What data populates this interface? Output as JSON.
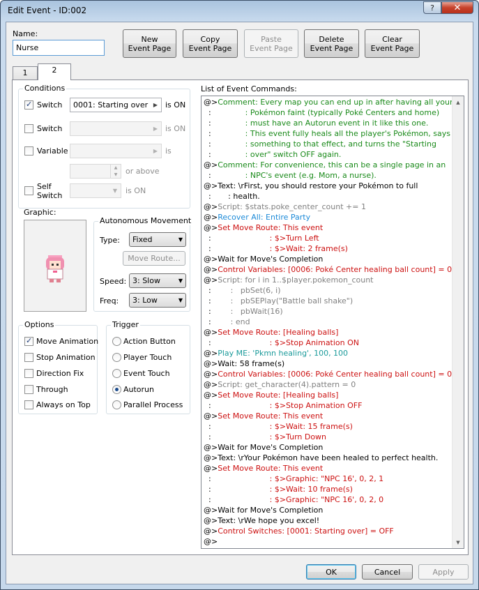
{
  "window": {
    "title": "Edit Event - ID:002",
    "help_glyph": "?",
    "close_glyph": "✕"
  },
  "name_label": "Name:",
  "name_value": "Nurse",
  "toolbar": {
    "new_page": [
      "New",
      "Event Page"
    ],
    "copy_page": [
      "Copy",
      "Event Page"
    ],
    "paste_page": [
      "Paste",
      "Event Page"
    ],
    "delete_page": [
      "Delete",
      "Event Page"
    ],
    "clear_page": [
      "Clear",
      "Event Page"
    ]
  },
  "tabs": [
    "1",
    "2"
  ],
  "active_tab": "2",
  "conditions": {
    "title": "Conditions",
    "switch1": {
      "label": "Switch",
      "checked": true,
      "value": "0001: Starting over",
      "suffix": "is ON"
    },
    "switch2": {
      "label": "Switch",
      "checked": false,
      "value": "",
      "suffix": "is ON"
    },
    "variable": {
      "label": "Variable",
      "checked": false,
      "value": "",
      "suffix": "is",
      "above": "or above"
    },
    "self_switch": {
      "label1": "Self",
      "label2": "Switch",
      "checked": false,
      "value": "",
      "suffix": "is ON"
    }
  },
  "graphic_label": "Graphic:",
  "autonomous": {
    "title": "Autonomous Movement",
    "type_label": "Type:",
    "type_value": "Fixed",
    "move_route": "Move Route...",
    "speed_label": "Speed:",
    "speed_value": "3: Slow",
    "freq_label": "Freq:",
    "freq_value": "3: Low"
  },
  "options": {
    "title": "Options",
    "items": [
      {
        "label": "Move Animation",
        "checked": true
      },
      {
        "label": "Stop Animation",
        "checked": false
      },
      {
        "label": "Direction Fix",
        "checked": false
      },
      {
        "label": "Through",
        "checked": false
      },
      {
        "label": "Always on Top",
        "checked": false
      }
    ]
  },
  "trigger": {
    "title": "Trigger",
    "items": [
      {
        "label": "Action Button",
        "checked": false
      },
      {
        "label": "Player Touch",
        "checked": false
      },
      {
        "label": "Event Touch",
        "checked": false
      },
      {
        "label": "Autorun",
        "checked": true
      },
      {
        "label": "Parallel Process",
        "checked": false
      }
    ]
  },
  "commands_label": "List of Event Commands:",
  "colors": {
    "comment": "#1a8a1a",
    "script": "#808080",
    "party": "#1c8ad8",
    "red": "#cc1010",
    "audio": "#1a9a9a",
    "text": "#000000"
  },
  "commands": [
    [
      [
        "text",
        "@>"
      ],
      [
        "comment",
        "Comment: Every map you can end up in after having all your"
      ]
    ],
    [
      [
        "text",
        "  :              "
      ],
      [
        "comment",
        ": Pokémon faint (typically Poké Centers and home)"
      ]
    ],
    [
      [
        "text",
        "  :              "
      ],
      [
        "comment",
        ": must have an Autorun event in it like this one."
      ]
    ],
    [
      [
        "text",
        "  :              "
      ],
      [
        "comment",
        ": This event fully heals all the player's Pokémon, says"
      ]
    ],
    [
      [
        "text",
        "  :              "
      ],
      [
        "comment",
        ": something to that effect, and turns the \"Starting"
      ]
    ],
    [
      [
        "text",
        "  :              "
      ],
      [
        "comment",
        ": over\" switch OFF again."
      ]
    ],
    [
      [
        "text",
        "@>"
      ],
      [
        "comment",
        "Comment: For convenience, this can be a single page in an"
      ]
    ],
    [
      [
        "text",
        "  :              "
      ],
      [
        "comment",
        ": NPC's event (e.g. Mom, a nurse)."
      ]
    ],
    [
      [
        "text",
        "@>Text: \\rFirst, you should restore your Pokémon to full"
      ]
    ],
    [
      [
        "text",
        "  :       : health."
      ]
    ],
    [
      [
        "text",
        "@>"
      ],
      [
        "script",
        "Script: $stats.poke_center_count += 1"
      ]
    ],
    [
      [
        "text",
        "@>"
      ],
      [
        "party",
        "Recover All: Entire Party"
      ]
    ],
    [
      [
        "text",
        "@>"
      ],
      [
        "red",
        "Set Move Route: This event"
      ]
    ],
    [
      [
        "text",
        "  :                        "
      ],
      [
        "red",
        ": $>Turn Left"
      ]
    ],
    [
      [
        "text",
        "  :                        "
      ],
      [
        "red",
        ": $>Wait: 2 frame(s)"
      ]
    ],
    [
      [
        "text",
        "@>Wait for Move's Completion"
      ]
    ],
    [
      [
        "text",
        "@>"
      ],
      [
        "red",
        "Control Variables: [0006: Poké Center healing ball count] = 0"
      ]
    ],
    [
      [
        "text",
        "@>"
      ],
      [
        "script",
        "Script: for i in 1..$player.pokemon_count"
      ]
    ],
    [
      [
        "text",
        "  :        "
      ],
      [
        "script",
        ":   pbSet(6, i)"
      ]
    ],
    [
      [
        "text",
        "  :        "
      ],
      [
        "script",
        ":   pbSEPlay(\"Battle ball shake\")"
      ]
    ],
    [
      [
        "text",
        "  :        "
      ],
      [
        "script",
        ":   pbWait(16)"
      ]
    ],
    [
      [
        "text",
        "  :        "
      ],
      [
        "script",
        ": end"
      ]
    ],
    [
      [
        "text",
        "@>"
      ],
      [
        "red",
        "Set Move Route: [Healing balls]"
      ]
    ],
    [
      [
        "text",
        "  :                        "
      ],
      [
        "red",
        ": $>Stop Animation ON"
      ]
    ],
    [
      [
        "text",
        "@>"
      ],
      [
        "audio",
        "Play ME: 'Pkmn healing', 100, 100"
      ]
    ],
    [
      [
        "text",
        "@>Wait: 58 frame(s)"
      ]
    ],
    [
      [
        "text",
        "@>"
      ],
      [
        "red",
        "Control Variables: [0006: Poké Center healing ball count] = 0"
      ]
    ],
    [
      [
        "text",
        "@>"
      ],
      [
        "script",
        "Script: get_character(4).pattern = 0"
      ]
    ],
    [
      [
        "text",
        "@>"
      ],
      [
        "red",
        "Set Move Route: [Healing balls]"
      ]
    ],
    [
      [
        "text",
        "  :                        "
      ],
      [
        "red",
        ": $>Stop Animation OFF"
      ]
    ],
    [
      [
        "text",
        "@>"
      ],
      [
        "red",
        "Set Move Route: This event"
      ]
    ],
    [
      [
        "text",
        "  :                        "
      ],
      [
        "red",
        ": $>Wait: 15 frame(s)"
      ]
    ],
    [
      [
        "text",
        "  :                        "
      ],
      [
        "red",
        ": $>Turn Down"
      ]
    ],
    [
      [
        "text",
        "@>Wait for Move's Completion"
      ]
    ],
    [
      [
        "text",
        "@>Text: \\rYour Pokémon have been healed to perfect health."
      ]
    ],
    [
      [
        "text",
        "@>"
      ],
      [
        "red",
        "Set Move Route: This event"
      ]
    ],
    [
      [
        "text",
        "  :                        "
      ],
      [
        "red",
        ": $>Graphic: \"NPC 16', 0, 2, 1"
      ]
    ],
    [
      [
        "text",
        "  :                        "
      ],
      [
        "red",
        ": $>Wait: 10 frame(s)"
      ]
    ],
    [
      [
        "text",
        "  :                        "
      ],
      [
        "red",
        ": $>Graphic: \"NPC 16', 0, 2, 0"
      ]
    ],
    [
      [
        "text",
        "@>Wait for Move's Completion"
      ]
    ],
    [
      [
        "text",
        "@>Text: \\rWe hope you excel!"
      ]
    ],
    [
      [
        "text",
        "@>"
      ],
      [
        "red",
        "Control Switches: [0001: Starting over] = OFF"
      ]
    ],
    [
      [
        "text",
        "@>"
      ]
    ]
  ],
  "footer": {
    "ok": "OK",
    "cancel": "Cancel",
    "apply": "Apply"
  },
  "icons": {
    "arrow_right": "▶",
    "arrow_down": "▼",
    "arrow_up": "▲",
    "spin_up": "▲",
    "spin_down": "▼"
  }
}
